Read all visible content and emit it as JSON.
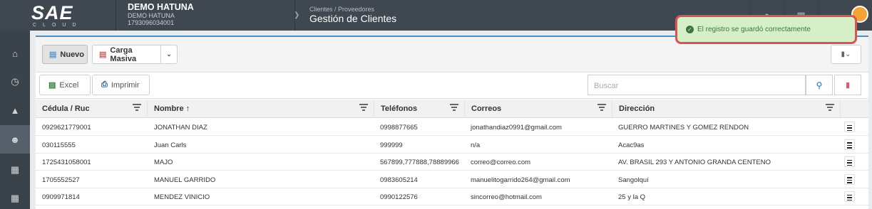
{
  "app": {
    "logo_text": "SAE",
    "logo_sub": "CLOUD"
  },
  "company": {
    "name": "DEMO HATUNA",
    "subname": "DEMO HATUNA",
    "ruc": "1793096034001"
  },
  "breadcrumb": {
    "path": "Clientes / Proveedores",
    "title": "Gestión de Clientes"
  },
  "toolbar": {
    "nuevo_label": "Nuevo",
    "carga_label": "Carga Masiva",
    "excel_label": "Excel",
    "imprimir_label": "Imprimir"
  },
  "search": {
    "placeholder": "Buscar"
  },
  "table": {
    "columns": [
      "Cédula / Ruc",
      "Nombre ↑",
      "Teléfonos",
      "Correos",
      "Dirección"
    ],
    "rows": [
      [
        "0929621779001",
        "JONATHAN DIAZ",
        "0998877665",
        "jonathandiaz0991@gmail.com",
        "GUERRO MARTINES Y GOMEZ RENDON"
      ],
      [
        "030115555",
        "Juan Carls",
        "999999",
        "n/a",
        "Acac9as"
      ],
      [
        "1725431058001",
        "MAJO",
        "567899,777888,78889966",
        "correo@correo.com",
        "AV. BRASIL 293 Y ANTONIO GRANDA CENTENO"
      ],
      [
        "1705552527",
        "MANUEL GARRIDO",
        "0983605214",
        "manuelitogarrido264@gmail.com",
        "Sangolquí"
      ],
      [
        "0909971814",
        "MENDEZ VINICIO",
        "0990122576",
        "sincorreo@hotmail.com",
        "25 y la Q"
      ]
    ]
  },
  "toast": {
    "message": "El registro se guardó correctamente"
  },
  "colors": {
    "topbar": "#3f4750",
    "sidebar": "#3a424a",
    "accent": "#4a90c8",
    "toast_bg": "#d5efc8",
    "toast_border": "#d9534f"
  }
}
